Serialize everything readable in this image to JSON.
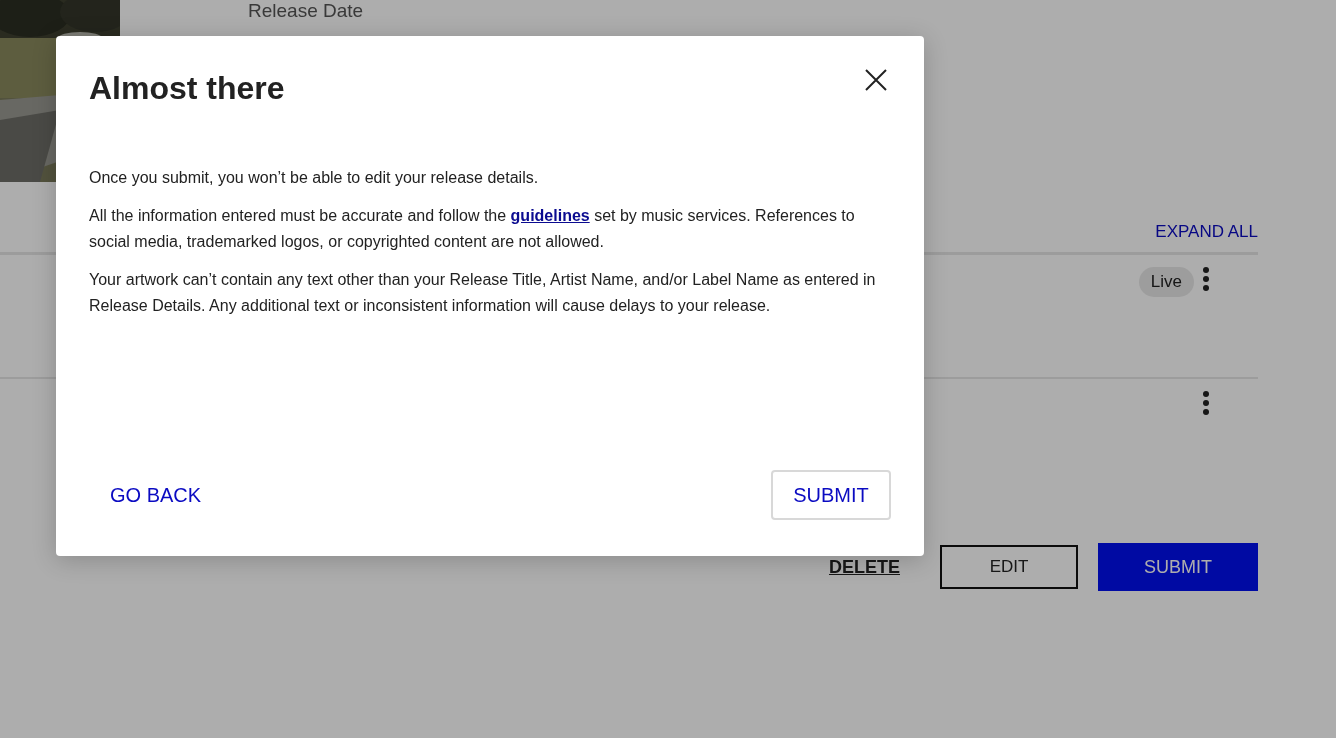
{
  "release": {
    "label": "Release Date"
  },
  "expand_all": "EXPAND ALL",
  "rows": [
    {
      "badge": "Live"
    },
    {}
  ],
  "actions": {
    "delete": "DELETE",
    "edit": "EDIT",
    "submit": "SUBMIT"
  },
  "dialog": {
    "title": "Almost there",
    "paragraphs": [
      {
        "parts": [
          {
            "kind": "text",
            "text": "Once you submit, you won’t be able to edit your release details."
          }
        ]
      },
      {
        "parts": [
          {
            "kind": "text",
            "text": "All the information entered must be accurate and follow the "
          },
          {
            "kind": "link",
            "text": "guidelines"
          },
          {
            "kind": "text",
            "text": " set by music services. References to social media, trademarked logos, or copyrighted content are not allowed."
          }
        ]
      },
      {
        "parts": [
          {
            "kind": "text",
            "text": "Your artwork can’t contain any text other than your Release Title, Artist Name, and/or Label Name as entered in Release Details. Any additional text or inconsistent information will cause delays to your release."
          }
        ]
      }
    ],
    "back": "GO BACK",
    "submit": "SUBMIT"
  }
}
